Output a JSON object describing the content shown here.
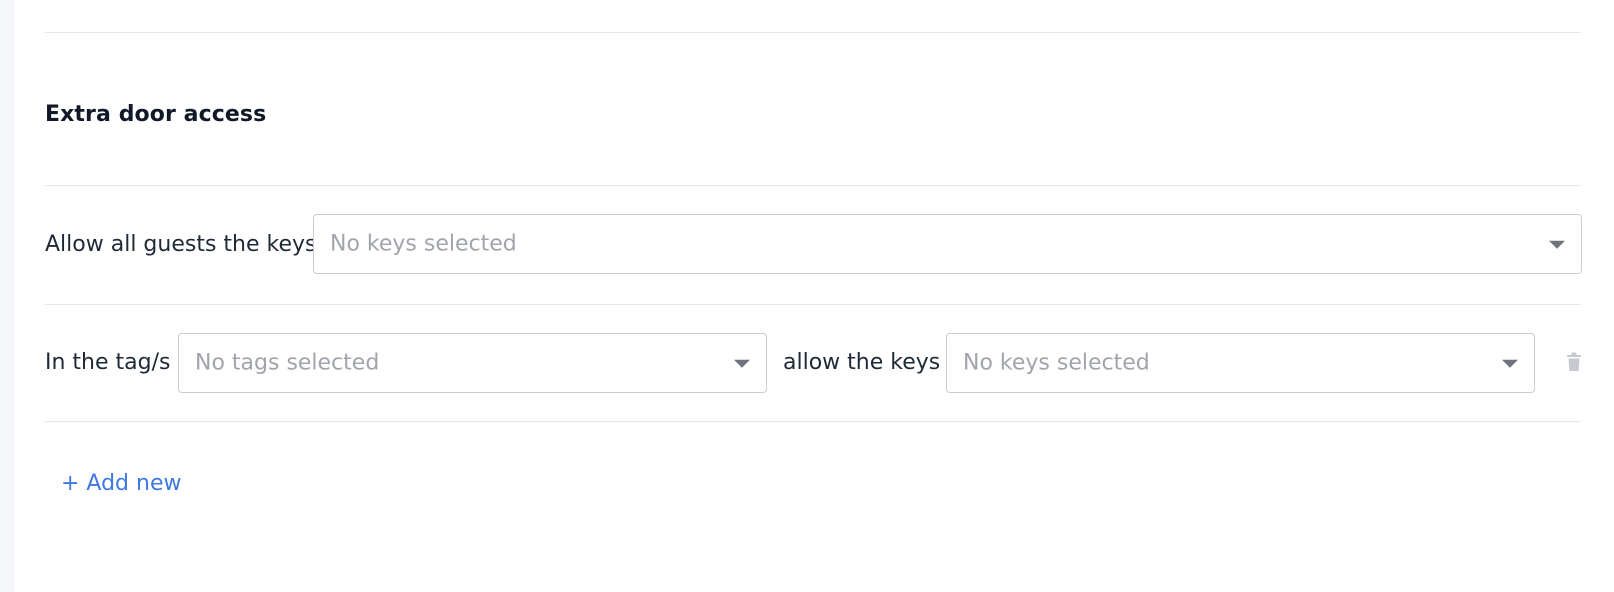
{
  "section": {
    "title": "Extra door access"
  },
  "all_guests_rule": {
    "label": "Allow all guests the keys",
    "keys_select": {
      "placeholder": "No keys selected"
    }
  },
  "tag_rules": [
    {
      "prefix_label": "In the tag/s",
      "tags_select": {
        "placeholder": "No tags selected"
      },
      "middle_label": "allow the keys",
      "keys_select": {
        "placeholder": "No keys selected"
      },
      "delete_icon": "trash-icon"
    }
  ],
  "actions": {
    "add_new_label": "+ Add new"
  },
  "colors": {
    "link": "#3f78e0",
    "border": "#c8ccd4",
    "placeholder": "#a1a5ab",
    "divider": "#e6e8ec"
  }
}
